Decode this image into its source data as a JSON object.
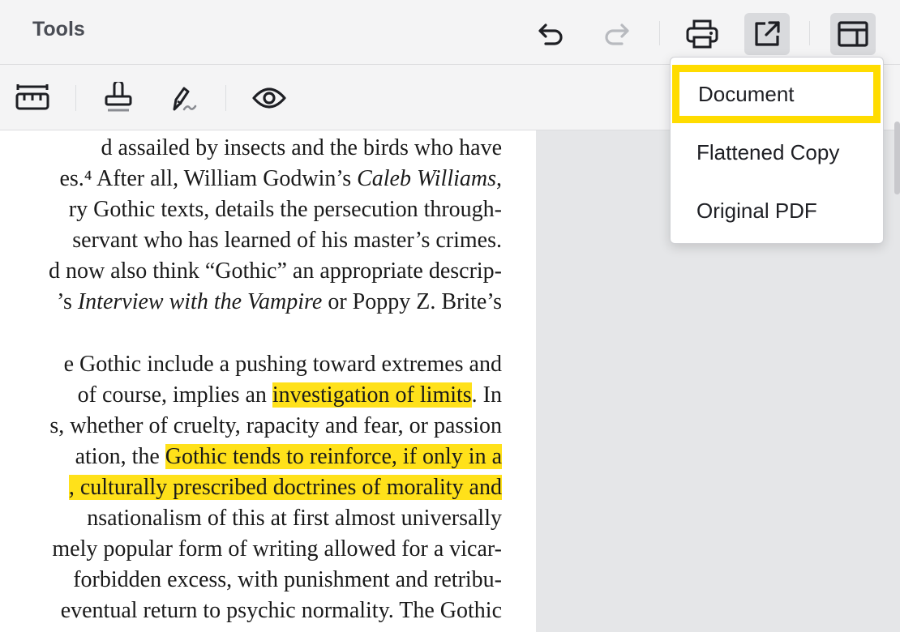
{
  "header": {
    "title": "Tools"
  },
  "toolbar": {
    "icons": [
      "undo-icon",
      "redo-icon",
      "print-icon",
      "export-icon",
      "layout-icon"
    ],
    "sub_icons": [
      "ruler-icon",
      "stamp-icon",
      "signature-icon",
      "eye-icon"
    ]
  },
  "export_menu": {
    "items": [
      "Document",
      "Flattened Copy",
      "Original PDF"
    ],
    "selected": "Document",
    "highlight_color": "#ffdc00"
  },
  "document": {
    "highlight_color": "#ffe11a",
    "paragraph1": [
      {
        "pre": "d assailed by insects and the birds who have"
      },
      {
        "pre": "es.⁴ After all, William Godwin’s ",
        "italic": "Caleb Williams",
        "post": ","
      },
      {
        "pre": "ry Gothic texts, details the persecution through-"
      },
      {
        "pre": "servant who has learned of his master’s crimes."
      },
      {
        "pre": "d now also think “Gothic” an appropriate descrip-"
      },
      {
        "pre": "’s ",
        "italic": "Interview with the Vampire",
        "post": " or Poppy Z. Brite’s"
      }
    ],
    "paragraph2": [
      {
        "pre": "e Gothic include a pushing toward extremes and"
      },
      {
        "pre": "of course, implies an ",
        "highlight": "investigation of limits",
        "post": ". In"
      },
      {
        "pre": "s, whether of cruelty, rapacity and fear, or passion"
      },
      {
        "pre": "ation, the ",
        "highlight": "Gothic tends to reinforce, if only in a"
      },
      {
        "highlight": ", culturally prescribed doctrines of morality and"
      },
      {
        "pre": "nsationalism of this at first almost universally"
      },
      {
        "pre": "mely popular form of writing allowed for a vicar-"
      },
      {
        "pre": " forbidden excess, with punishment and retribu-"
      },
      {
        "pre": "eventual return to psychic normality. The Gothic"
      }
    ]
  }
}
